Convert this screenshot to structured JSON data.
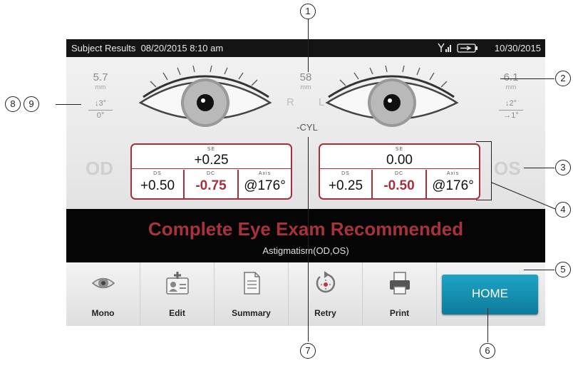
{
  "status_bar": {
    "title": "Subject Results",
    "datetime": "08/20/2015 8:10 am",
    "date": "10/30/2015",
    "signal_icon": "signal-icon",
    "battery_icon": "battery-icon"
  },
  "center": {
    "pd_value": "58",
    "pd_unit": "mm",
    "right_letter": "R",
    "left_letter": "L",
    "cyl_mode": "-CYL"
  },
  "od": {
    "label": "OD",
    "pupil_value": "5.7",
    "pupil_unit": "mm",
    "gaze_top": "↓3°",
    "gaze_bottom": "0°",
    "se_label": "SE",
    "se_value": "+0.25",
    "ds_label": "DS",
    "ds_value": "+0.50",
    "dc_label": "DC",
    "dc_value": "-0.75",
    "axis_label": "Axis",
    "axis_value": "@176°"
  },
  "os": {
    "label": "OS",
    "pupil_value": "6.1",
    "pupil_unit": "mm",
    "gaze_top": "↓2°",
    "gaze_bottom": "→1°",
    "se_label": "SE",
    "se_value": "0.00",
    "ds_label": "DS",
    "ds_value": "+0.25",
    "dc_label": "DC",
    "dc_value": "-0.50",
    "axis_label": "Axis",
    "axis_value": "@176°"
  },
  "banner": {
    "message": "Complete Eye Exam Recommended",
    "detail": "Astigmatism(OD,OS)"
  },
  "toolbar": {
    "mono": "Mono",
    "edit": "Edit",
    "summary": "Summary",
    "retry": "Retry",
    "print": "Print",
    "home": "HOME"
  },
  "callouts": [
    "1",
    "2",
    "3",
    "4",
    "5",
    "6",
    "7",
    "8",
    "9"
  ],
  "colors": {
    "accent_red": "#a4303b",
    "home_blue": "#1591b3",
    "banner_bg": "#050505"
  }
}
